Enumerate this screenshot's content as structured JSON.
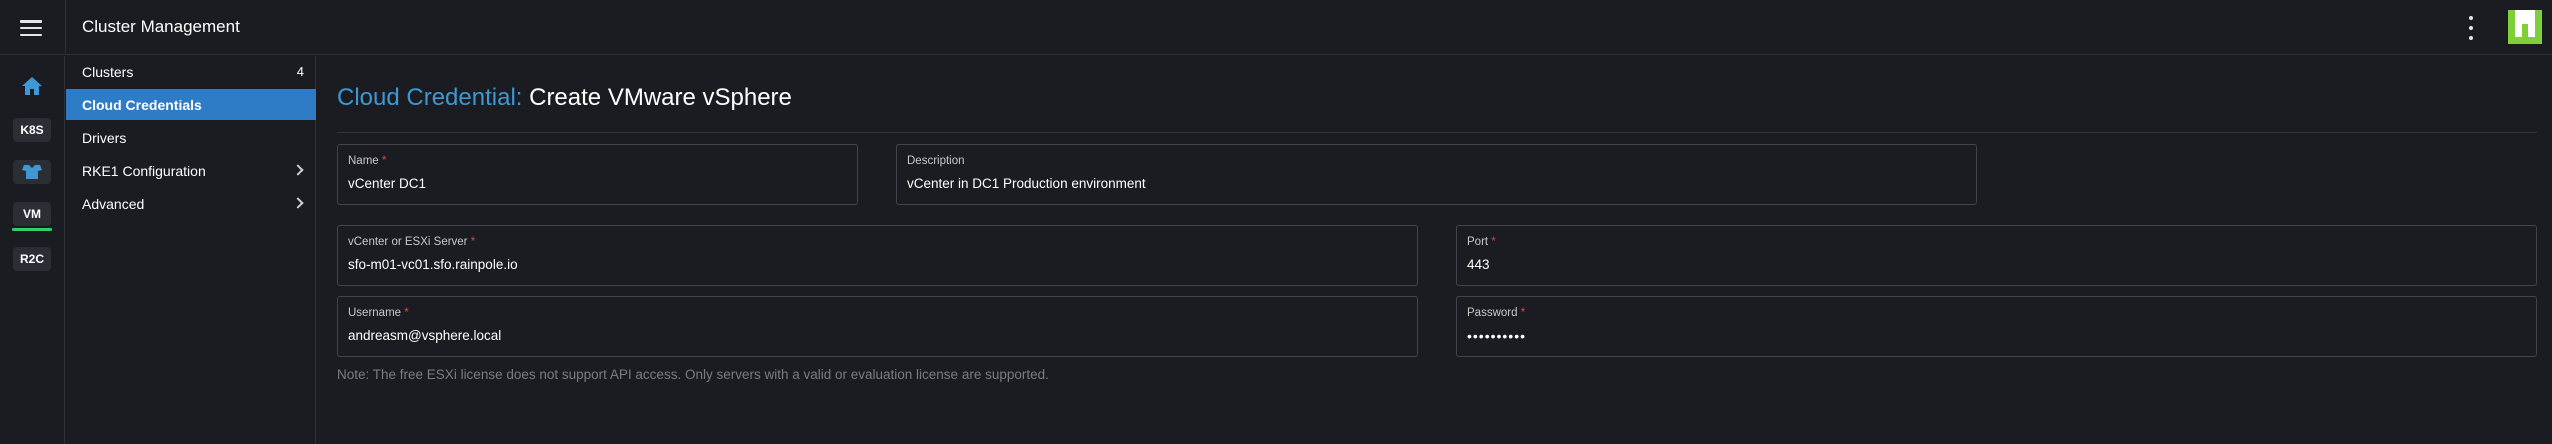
{
  "header": {
    "title": "Cluster Management"
  },
  "rail": {
    "items": [
      {
        "label": "K8S"
      },
      {
        "label": "VM"
      },
      {
        "label": "R2C"
      }
    ]
  },
  "subnav": {
    "items": [
      {
        "label": "Clusters",
        "count": "4"
      },
      {
        "label": "Cloud Credentials"
      },
      {
        "label": "Drivers"
      },
      {
        "label": "RKE1 Configuration"
      },
      {
        "label": "Advanced"
      }
    ]
  },
  "page": {
    "title_prefix": "Cloud Credential:",
    "title_main": "Create VMware vSphere"
  },
  "form": {
    "name": {
      "label": "Name",
      "required": "*",
      "value": "vCenter DC1"
    },
    "description": {
      "label": "Description",
      "value": "vCenter in DC1 Production environment"
    },
    "server": {
      "label": "vCenter or ESXi Server",
      "required": "*",
      "value": "sfo-m01-vc01.sfo.rainpole.io"
    },
    "port": {
      "label": "Port",
      "required": "*",
      "value": "443"
    },
    "username": {
      "label": "Username",
      "required": "*",
      "value": "andreasm@vsphere.local"
    },
    "password": {
      "label": "Password",
      "required": "*",
      "value": "••••••••••"
    },
    "note": "Note: The free ESXi license does not support API access. Only servers with a valid or evaluation license are supported."
  },
  "colors": {
    "accent": "#2e7bc6",
    "title_prefix": "#3d98d3",
    "active_indicator": "#2fd166",
    "required": "#e0463c"
  }
}
